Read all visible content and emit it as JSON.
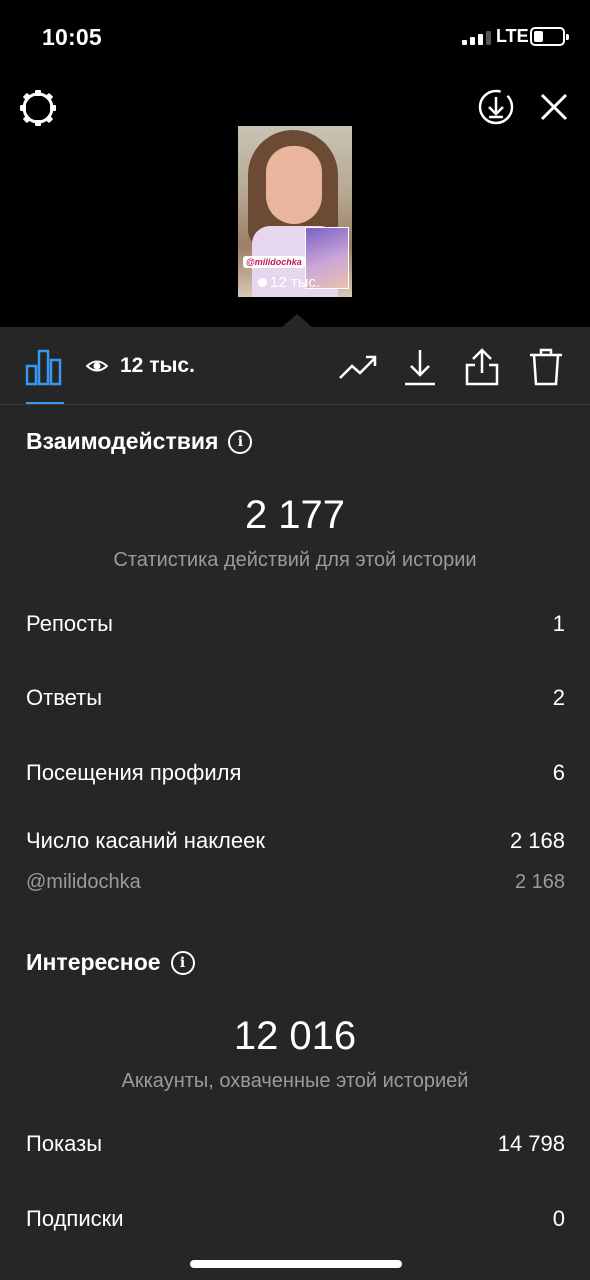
{
  "status_bar": {
    "time": "10:05",
    "network": "LTE"
  },
  "story": {
    "sticker_tag": "@milidochka",
    "view_count": "12 тыс."
  },
  "toolbar": {
    "view_count": "12 тыс."
  },
  "interactions": {
    "title": "Взаимодействия",
    "total": "2 177",
    "subtitle": "Статистика действий для этой истории",
    "rows": [
      {
        "label": "Репосты",
        "value": "1"
      },
      {
        "label": "Ответы",
        "value": "2"
      },
      {
        "label": "Посещения профиля",
        "value": "6"
      },
      {
        "label": "Число касаний наклеек",
        "value": "2 168"
      }
    ],
    "sub_row": {
      "label": "@milidochka",
      "value": "2 168"
    }
  },
  "discovery": {
    "title": "Интересное",
    "total": "12 016",
    "subtitle": "Аккаунты, охваченные этой историей",
    "rows": [
      {
        "label": "Показы",
        "value": "14 798"
      },
      {
        "label": "Подписки",
        "value": "0"
      }
    ]
  },
  "colors": {
    "accent": "#3897f0",
    "panel": "#262626",
    "muted": "#9b9b9b"
  }
}
